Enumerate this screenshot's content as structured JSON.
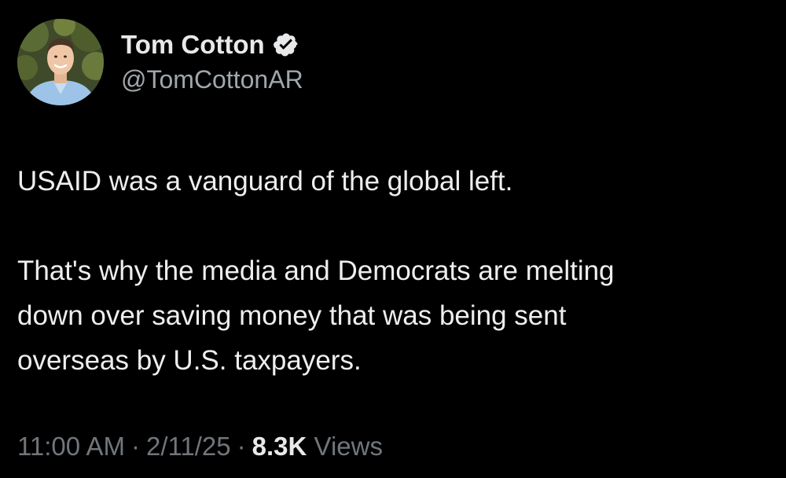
{
  "author": {
    "display_name": "Tom Cotton",
    "handle": "@TomCottonAR",
    "verified_icon": "verified-badge",
    "badge_color": "#e7e9ea"
  },
  "tweet": {
    "paragraphs": [
      "USAID was a vanguard of the global left.",
      "That's why the media and Democrats are melting\ndown over saving money that was being sent\noverseas by U.S. taxpayers."
    ]
  },
  "meta": {
    "time": "11:00 AM",
    "separator": "·",
    "date": "2/11/25",
    "views_count": "8.3K",
    "views_label": "Views"
  },
  "theme": {
    "background": "#000000",
    "text": "#e7e9ea",
    "secondary": "#71767b"
  }
}
